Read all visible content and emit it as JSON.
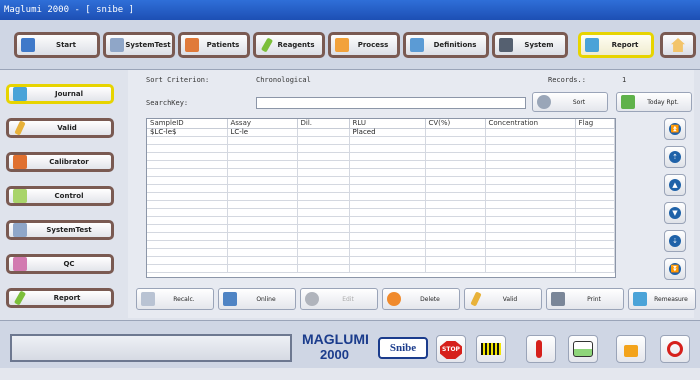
{
  "window": {
    "title": "Maglumi 2000 - [ snibe ]"
  },
  "toolbar": {
    "start": "Start",
    "systemtest": "SystemTest",
    "patients": "Patients",
    "reagents": "Reagents",
    "process": "Process",
    "definitions": "Definitions",
    "system": "System",
    "report": "Report"
  },
  "sidebar": {
    "journal": "Journal",
    "valid": "Valid",
    "calibrator": "Calibrator",
    "control": "Control",
    "systemtest": "SystemTest",
    "qc": "QC",
    "report": "Report"
  },
  "main": {
    "sort_label": "Sort Criterion:",
    "sort_value": "Chronological",
    "records_label": "Records.:",
    "records_value": "1",
    "searchkey_label": "SearchKey:",
    "search_value": "",
    "sort_btn": "Sort",
    "today_btn": "Today Rpt."
  },
  "table": {
    "headers": [
      "SampleID",
      "Assay",
      "Dil.",
      "RLU",
      "CV(%)",
      "Concentration",
      "Flag"
    ],
    "rows": [
      {
        "sampleid": "$LC-le$",
        "assay": "LC-le",
        "dil": "",
        "rlu": "Placed",
        "cv": "",
        "conc": "",
        "flag": ""
      }
    ]
  },
  "actions": {
    "recalc": "Recalc.",
    "online": "Online",
    "edit": "Edit",
    "delete": "Delete",
    "valid": "Valid",
    "print": "Print",
    "remeasure": "Remeasure"
  },
  "logo": {
    "maglumi": "MAGLUMI",
    "model": "2000",
    "snibe": "Snibe"
  },
  "stop_label": "STOP",
  "colors": {
    "accent_border": "#7a5a52",
    "active_border": "#e7d400",
    "nav_blue": "#1f62a8",
    "stop_red": "#d6201b"
  }
}
